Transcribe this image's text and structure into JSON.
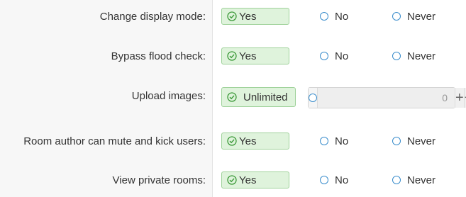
{
  "settings": [
    {
      "label": "Change display mode:",
      "selected": "Yes",
      "option_no": "No",
      "option_never": "Never"
    },
    {
      "label": "Bypass flood check:",
      "selected": "Yes",
      "option_no": "No",
      "option_never": "Never"
    },
    {
      "label": "Upload images:",
      "selected": "Unlimited",
      "value": "0",
      "plus": "+",
      "minus": "−"
    },
    {
      "label": "Room author can mute and kick users:",
      "selected": "Yes",
      "option_no": "No",
      "option_never": "Never"
    },
    {
      "label": "View private rooms:",
      "selected": "Yes",
      "option_no": "No",
      "option_never": "Never"
    }
  ],
  "colors": {
    "selected_bg": "#dff3dc",
    "selected_border": "#9fd29a",
    "check": "#3d9a3a",
    "radio": "#3a8dcc"
  }
}
